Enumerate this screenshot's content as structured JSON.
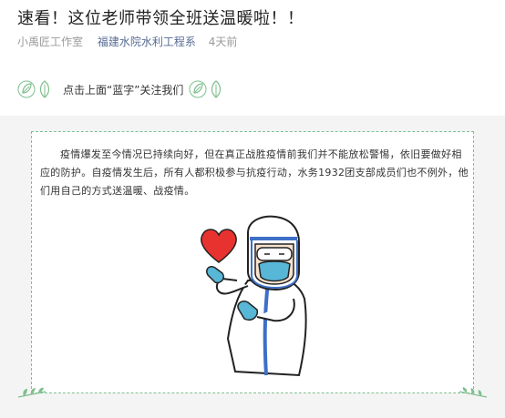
{
  "article": {
    "title": "速看！这位老师带领全班送温暖啦！！",
    "author": "小禹匠工作室",
    "account": "福建水院水利工程系",
    "time": "4天前"
  },
  "follow": {
    "text": "点击上面“蓝字”关注我们"
  },
  "body": {
    "paragraph": "疫情爆发至今情况已持续向好，但在真正战胜疫情前我们并不能放松警惕，依旧要做好相应的防护。自疫情发生后，所有人都积极参与抗疫行动，水务1932团支部成员们也不例外，他们用自己的方式送温暖、战疫情。"
  },
  "icons": {
    "leaf": "leaf-icon",
    "heart": "heart-icon",
    "illustration": "medical-worker-illustration"
  },
  "colors": {
    "title": "#222222",
    "link": "#576b95",
    "meta": "#9a9a9a",
    "leaf_green": "#7fbf8e",
    "heart_red": "#e8322f",
    "suit_blue": "#3d6fc7",
    "mask_teal": "#58b6d6"
  }
}
